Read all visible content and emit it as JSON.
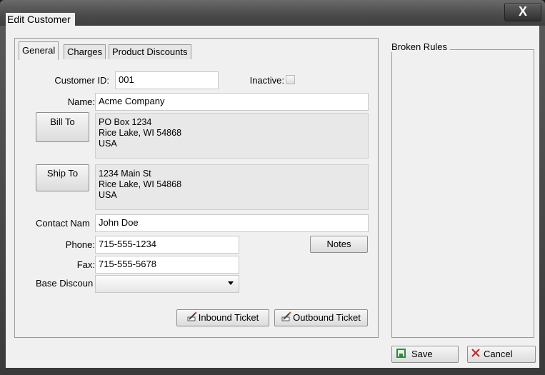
{
  "window": {
    "title": "Edit Customer",
    "close_label": "X"
  },
  "tabs": [
    {
      "label": "General",
      "active": true
    },
    {
      "label": "Charges",
      "active": false
    },
    {
      "label": "Product Discounts",
      "active": false
    }
  ],
  "form": {
    "customer_id_label": "Customer ID:",
    "customer_id_value": "001",
    "inactive_label": "Inactive:",
    "inactive_checked": false,
    "name_label": "Name:",
    "name_value": "Acme Company",
    "bill_to_button": "Bill To",
    "bill_to_lines": [
      "PO Box 1234",
      "Rice Lake, WI 54868",
      "USA"
    ],
    "ship_to_button": "Ship To",
    "ship_to_lines": [
      "1234 Main St",
      "Rice Lake, WI 54868",
      "USA"
    ],
    "contact_label": "Contact Nam",
    "contact_value": "John Doe",
    "phone_label": "Phone:",
    "phone_value": "715-555-1234",
    "notes_button": "Notes",
    "fax_label": "Fax:",
    "fax_value": "715-555-5678",
    "base_discount_label": "Base Discoun",
    "base_discount_value": "",
    "inbound_ticket_button": "Inbound Ticket",
    "outbound_ticket_button": "Outbound Ticket"
  },
  "broken_rules": {
    "title": "Broken Rules",
    "items": []
  },
  "footer": {
    "save_label": "Save",
    "cancel_label": "Cancel"
  },
  "icons": {
    "save": "save-icon",
    "cancel": "cancel-x-icon",
    "inbound": "ticket-pencil-icon",
    "outbound": "ticket-pencil-icon",
    "close": "close-icon"
  },
  "colors": {
    "save_icon": "#2e8b3a",
    "cancel_icon": "#d02020"
  }
}
